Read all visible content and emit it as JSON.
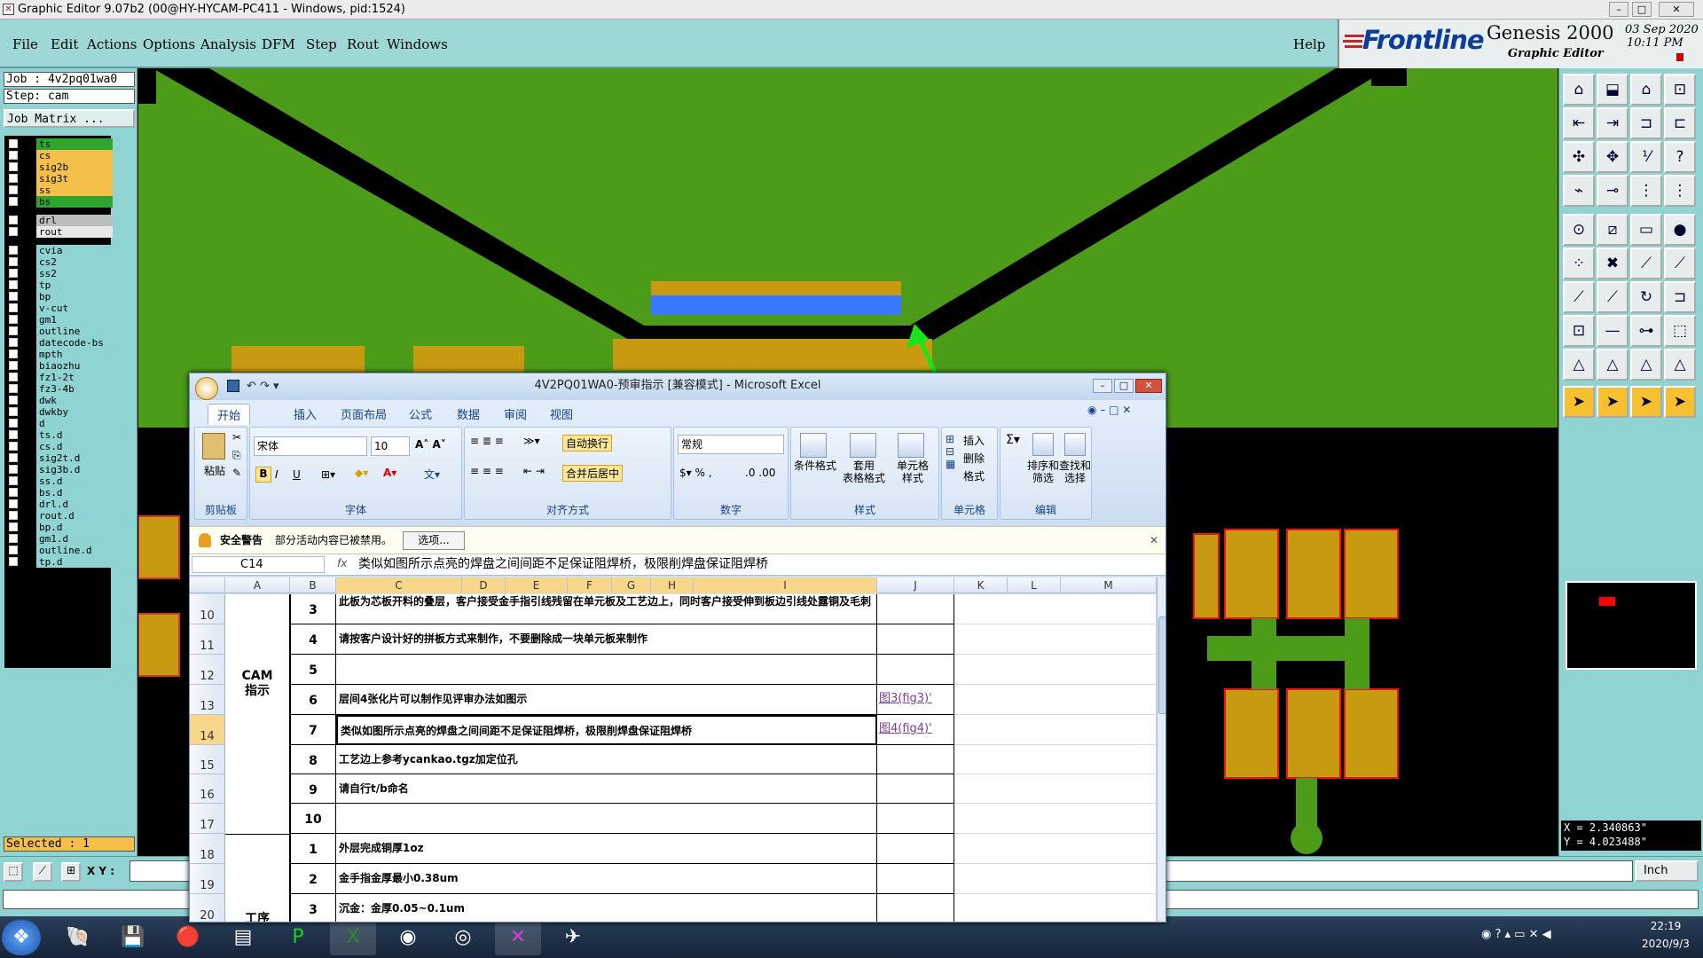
{
  "window": {
    "title": "Graphic Editor 9.07b2 (00@HY-HYCAM-PC411 - Windows, pid:1524)",
    "min": "–",
    "max": "□",
    "close": "✕"
  },
  "menu": {
    "items": [
      "File",
      "Edit",
      "Actions",
      "Options",
      "Analysis",
      "DFM",
      "Step",
      "Rout",
      "Windows"
    ],
    "help": "Help"
  },
  "brand": {
    "logo": "Frontline",
    "product": "Genesis 2000",
    "subtitle": "Graphic Editor",
    "date": "03 Sep 2020",
    "time": "10:11 PM"
  },
  "job": {
    "job_label": "Job  : 4v2pq01wa0",
    "step_label": "Step: cam",
    "matrix_button": "Job Matrix ..."
  },
  "layers": [
    {
      "name": "ts",
      "color": "#2ea52e"
    },
    {
      "name": "cs",
      "color": "#f5c04a"
    },
    {
      "name": "sig2b",
      "color": "#f5c04a"
    },
    {
      "name": "sig3t",
      "color": "#f5c04a"
    },
    {
      "name": "ss",
      "color": "#f5c04a"
    },
    {
      "name": "bs",
      "color": "#2ea52e"
    },
    {
      "name": "drl",
      "color": "#bcbcbc"
    },
    {
      "name": "rout",
      "color": "#e8e8e8"
    },
    {
      "name": "cvia",
      "color": "#8fd4d2"
    },
    {
      "name": "cs2",
      "color": "#8fd4d2"
    },
    {
      "name": "ss2",
      "color": "#8fd4d2"
    },
    {
      "name": "tp",
      "color": "#8fd4d2"
    },
    {
      "name": "bp",
      "color": "#8fd4d2"
    },
    {
      "name": "v-cut",
      "color": "#8fd4d2"
    },
    {
      "name": "gm1",
      "color": "#8fd4d2"
    },
    {
      "name": "outline",
      "color": "#8fd4d2"
    },
    {
      "name": "datecode-bs",
      "color": "#8fd4d2"
    },
    {
      "name": "mpth",
      "color": "#8fd4d2"
    },
    {
      "name": "biaozhu",
      "color": "#8fd4d2"
    },
    {
      "name": "fz1-2t",
      "color": "#8fd4d2"
    },
    {
      "name": "fz3-4b",
      "color": "#8fd4d2"
    },
    {
      "name": "dwk",
      "color": "#8fd4d2"
    },
    {
      "name": "dwkby",
      "color": "#8fd4d2"
    },
    {
      "name": "d",
      "color": "#8fd4d2"
    },
    {
      "name": "ts.d",
      "color": "#8fd4d2"
    },
    {
      "name": "cs.d",
      "color": "#8fd4d2"
    },
    {
      "name": "sig2t.d",
      "color": "#8fd4d2"
    },
    {
      "name": "sig3b.d",
      "color": "#8fd4d2"
    },
    {
      "name": "ss.d",
      "color": "#8fd4d2"
    },
    {
      "name": "bs.d",
      "color": "#8fd4d2"
    },
    {
      "name": "drl.d",
      "color": "#8fd4d2"
    },
    {
      "name": "rout.d",
      "color": "#8fd4d2"
    },
    {
      "name": "bp.d",
      "color": "#8fd4d2"
    },
    {
      "name": "gm1.d",
      "color": "#8fd4d2"
    },
    {
      "name": "outline.d",
      "color": "#8fd4d2"
    },
    {
      "name": "tp.d",
      "color": "#8fd4d2"
    }
  ],
  "status": {
    "selected": "Selected : 1",
    "xy_label": "X Y :",
    "x_readout": "X = 2.340863\"",
    "y_readout": "Y = 4.023488\"",
    "unit": "Inch"
  },
  "excel": {
    "title": "4V2PQ01WA0-预审指示  [兼容模式] - Microsoft Excel",
    "tabs": [
      "开始",
      "插入",
      "页面布局",
      "公式",
      "数据",
      "审阅",
      "视图"
    ],
    "groups": {
      "clipboard": "剪贴板",
      "font": "字体",
      "align": "对齐方式",
      "number": "数字",
      "style": "样式",
      "cells": "单元格",
      "edit": "编辑"
    },
    "paste": "粘贴",
    "font_name": "宋体",
    "font_size": "10",
    "wrap": "自动换行",
    "merge": "合并后居中",
    "num_format": "常规",
    "cond_format": "条件格式",
    "table_format": "套用\n表格格式",
    "cell_style": "单元格\n样式",
    "insert": "插入",
    "delete": "删除",
    "format": "格式",
    "sort": "排序和\n筛选",
    "find": "查找和\n选择",
    "security_title": "安全警告",
    "security_msg": "部分活动内容已被禁用。",
    "security_btn": "选项...",
    "name_box": "C14",
    "fx": "fx",
    "formula": "类似如图所示点亮的焊盘之间间距不足保证阻焊桥，极限削焊盘保证阻焊桥",
    "columns": [
      "A",
      "B",
      "C",
      "D",
      "E",
      "F",
      "G",
      "H",
      "I",
      "J",
      "K",
      "L",
      "M"
    ],
    "cam_label": "CAM\n指示",
    "process_label": "工序",
    "rows": [
      {
        "r": "10",
        "b": "3",
        "c": "此板为芯板开料的叠层，客户接受金手指引线残留在单元板及工艺边上，同时客户接受伸到板边引线处露铜及毛刺",
        "j": ""
      },
      {
        "r": "11",
        "b": "4",
        "c": "请按客户设计好的拼板方式来制作，不要删除成一块单元板来制作",
        "j": ""
      },
      {
        "r": "12",
        "b": "5",
        "c": "",
        "j": ""
      },
      {
        "r": "13",
        "b": "6",
        "c": "层间4张化片可以制作见评审办法如图示",
        "j": "图3(fig3)'"
      },
      {
        "r": "14",
        "b": "7",
        "c": "类似如图所示点亮的焊盘之间间距不足保证阻焊桥，极限削焊盘保证阻焊桥",
        "j": "图4(fig4)'"
      },
      {
        "r": "15",
        "b": "8",
        "c": "工艺边上参考ycankao.tgz加定位孔",
        "j": ""
      },
      {
        "r": "16",
        "b": "9",
        "c": "请自行t/b命名",
        "j": ""
      },
      {
        "r": "17",
        "b": "10",
        "c": "",
        "j": ""
      },
      {
        "r": "18",
        "b": "1",
        "c": "外层完成铜厚1oz",
        "j": ""
      },
      {
        "r": "19",
        "b": "2",
        "c": "金手指金厚最小0.38um",
        "j": ""
      },
      {
        "r": "20",
        "b": "3",
        "c": "沉金：金厚0.05~0.1um",
        "j": ""
      }
    ]
  },
  "tray": {
    "time": "22:19",
    "date": "2020/9/3"
  },
  "colors": {
    "board": "#4c9c1a",
    "pad": "#c89a12",
    "highlight": "#3a78ff",
    "arrow": "#19e619"
  }
}
